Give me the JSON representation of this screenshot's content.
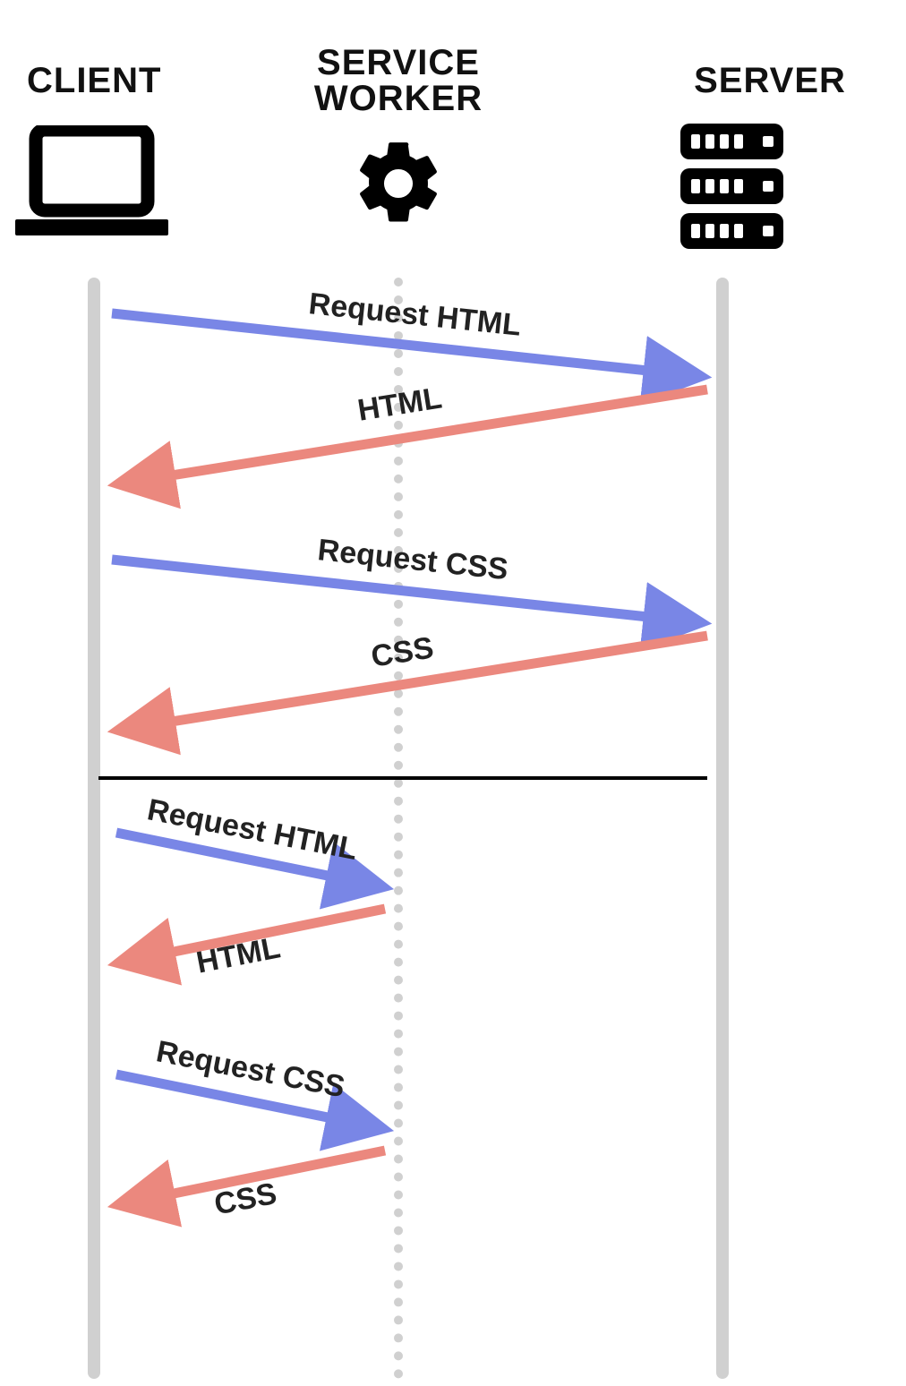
{
  "headers": {
    "client": "CLIENT",
    "service_worker_line1": "SERVICE",
    "service_worker_line2": "WORKER",
    "server": "SERVER"
  },
  "colors": {
    "request": "#7986e6",
    "response": "#eb887e",
    "lifeline": "#d0d0d0"
  },
  "messages": {
    "top": [
      {
        "label": "Request HTML",
        "dir": "request",
        "target": "server"
      },
      {
        "label": "HTML",
        "dir": "response",
        "target": "server"
      },
      {
        "label": "Request CSS",
        "dir": "request",
        "target": "server"
      },
      {
        "label": "CSS",
        "dir": "response",
        "target": "server"
      }
    ],
    "bottom": [
      {
        "label": "Request HTML",
        "dir": "request",
        "target": "sw"
      },
      {
        "label": "HTML",
        "dir": "response",
        "target": "sw"
      },
      {
        "label": "Request CSS",
        "dir": "request",
        "target": "sw"
      },
      {
        "label": "CSS",
        "dir": "response",
        "target": "sw"
      }
    ]
  }
}
